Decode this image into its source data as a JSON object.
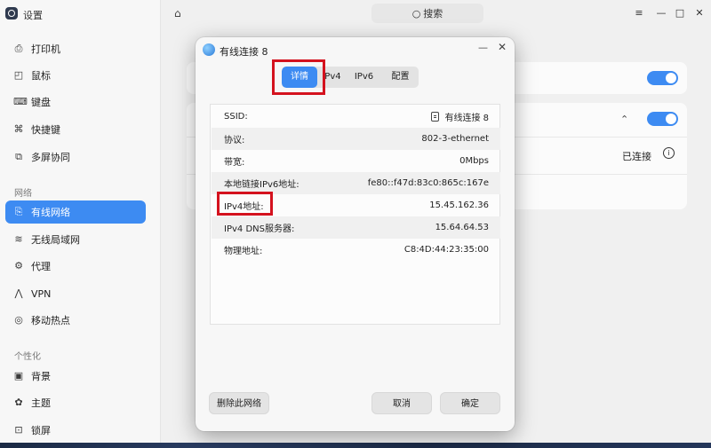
{
  "app": {
    "title": "设置"
  },
  "sidebar": {
    "items": [
      {
        "label": "打印机",
        "icon": "printer-icon",
        "glyph": "⎙"
      },
      {
        "label": "鼠标",
        "icon": "mouse-icon",
        "glyph": "◰"
      },
      {
        "label": "键盘",
        "icon": "keyboard-icon",
        "glyph": "⌨"
      },
      {
        "label": "快捷键",
        "icon": "shortcut-icon",
        "glyph": "⌘"
      },
      {
        "label": "多屏协同",
        "icon": "multiscreen-icon",
        "glyph": "⧉"
      }
    ],
    "network_group": "网络",
    "network_items": [
      {
        "label": "有线网络",
        "icon": "wired-network-icon",
        "glyph": "⎘"
      },
      {
        "label": "无线局域网",
        "icon": "wifi-icon",
        "glyph": "≋"
      },
      {
        "label": "代理",
        "icon": "proxy-icon",
        "glyph": "⚙"
      },
      {
        "label": "VPN",
        "icon": "vpn-icon",
        "glyph": "⋀"
      },
      {
        "label": "移动热点",
        "icon": "hotspot-icon",
        "glyph": "◎"
      }
    ],
    "personal_group": "个性化",
    "personal_items": [
      {
        "label": "背景",
        "icon": "wallpaper-icon",
        "glyph": "▣"
      },
      {
        "label": "主题",
        "icon": "theme-icon",
        "glyph": "✿"
      },
      {
        "label": "锁屏",
        "icon": "lockscreen-icon",
        "glyph": "⊡"
      }
    ]
  },
  "topbar": {
    "search_label": "搜索"
  },
  "background": {
    "status": "已连接"
  },
  "dialog": {
    "title": "有线连接 8",
    "tabs": [
      "详情",
      "IPv4",
      "IPv6",
      "配置"
    ],
    "rows": [
      {
        "key": "SSID:",
        "value": "有线连接 8"
      },
      {
        "key": "协议:",
        "value": "802-3-ethernet"
      },
      {
        "key": "带宽:",
        "value": "0Mbps"
      },
      {
        "key": "本地链接IPv6地址:",
        "value": "fe80::f47d:83c0:865c:167e"
      },
      {
        "key": "IPv4地址:",
        "value": "15.45.162.36"
      },
      {
        "key": "IPv4 DNS服务器:",
        "value": "15.64.64.53"
      },
      {
        "key": "物理地址:",
        "value": "C8:4D:44:23:35:00"
      }
    ],
    "buttons": {
      "delete": "删除此网络",
      "cancel": "取消",
      "confirm": "确定"
    }
  },
  "colors": {
    "accent": "#3d8bf2",
    "highlight": "#d4121e"
  }
}
